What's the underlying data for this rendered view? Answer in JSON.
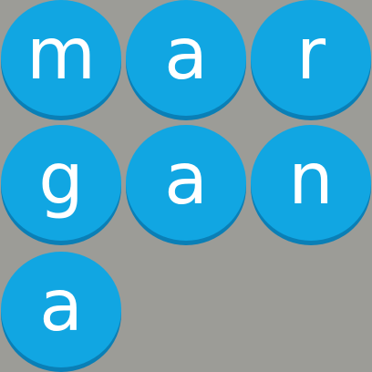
{
  "board": {
    "tiles": [
      {
        "letter": "m"
      },
      {
        "letter": "a"
      },
      {
        "letter": "r"
      },
      {
        "letter": "g"
      },
      {
        "letter": "a"
      },
      {
        "letter": "n"
      },
      {
        "letter": "a"
      }
    ]
  },
  "colors": {
    "background": "#9c9c97",
    "tile": "#11a6e2",
    "tile_shadow": "#0a7fb6",
    "letter": "#ffffff"
  }
}
